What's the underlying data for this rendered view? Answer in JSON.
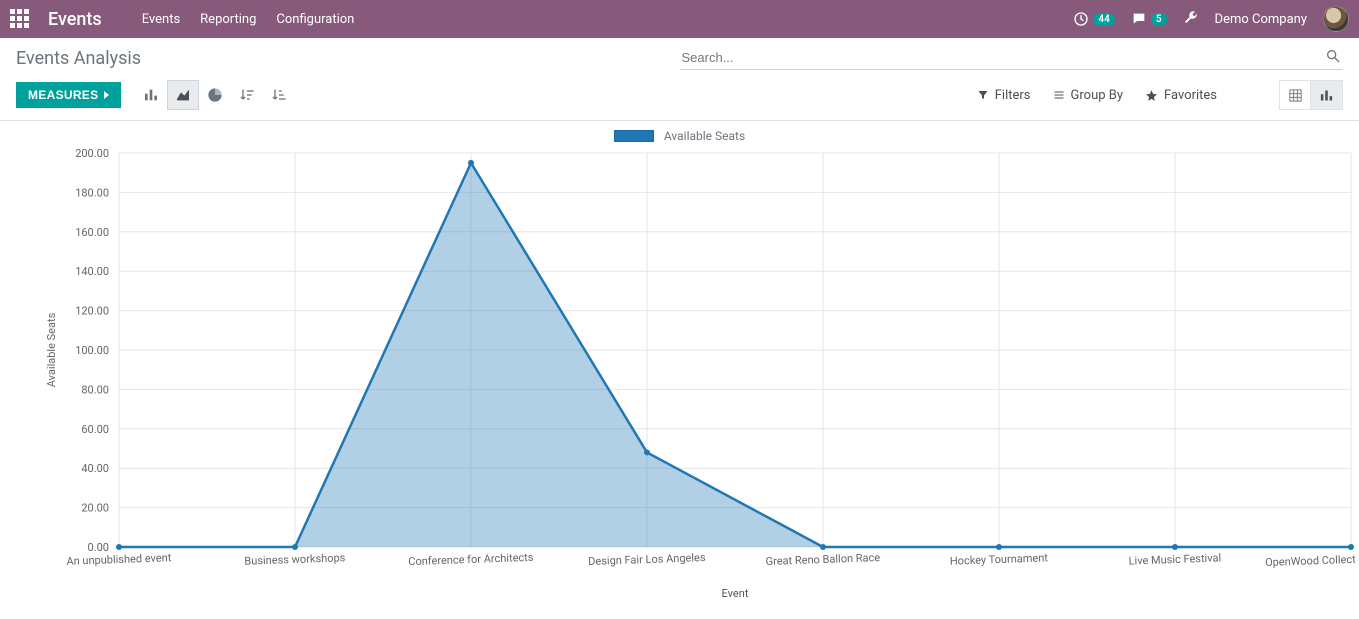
{
  "topbar": {
    "brand": "Events",
    "nav": [
      "Events",
      "Reporting",
      "Configuration"
    ],
    "activity_badge": "44",
    "chat_badge": "5",
    "company": "Demo Company"
  },
  "page": {
    "title": "Events Analysis",
    "search_placeholder": "Search..."
  },
  "toolbar": {
    "measures_label": "MEASURES",
    "filters_label": "Filters",
    "groupby_label": "Group By",
    "favorites_label": "Favorites"
  },
  "chart_data": {
    "type": "area",
    "title": "",
    "xlabel": "Event",
    "ylabel": "Available Seats",
    "ylim": [
      0,
      200
    ],
    "yticks": [
      0,
      20,
      40,
      60,
      80,
      100,
      120,
      140,
      160,
      180,
      200
    ],
    "ytick_labels": [
      "0.00",
      "20.00",
      "40.00",
      "60.00",
      "80.00",
      "100.00",
      "120.00",
      "140.00",
      "160.00",
      "180.00",
      "200.00"
    ],
    "categories": [
      "An unpublished event",
      "Business workshops",
      "Conference for Architects",
      "Design Fair Los Angeles",
      "Great Reno Ballon Race",
      "Hockey Tournament",
      "Live Music Festival",
      "OpenWood Collection Online Revea"
    ],
    "series": [
      {
        "name": "Available Seats",
        "values": [
          0,
          0,
          195,
          48,
          0,
          0,
          0,
          0
        ]
      }
    ],
    "legend": {
      "position": "top",
      "entries": [
        "Available Seats"
      ]
    }
  }
}
